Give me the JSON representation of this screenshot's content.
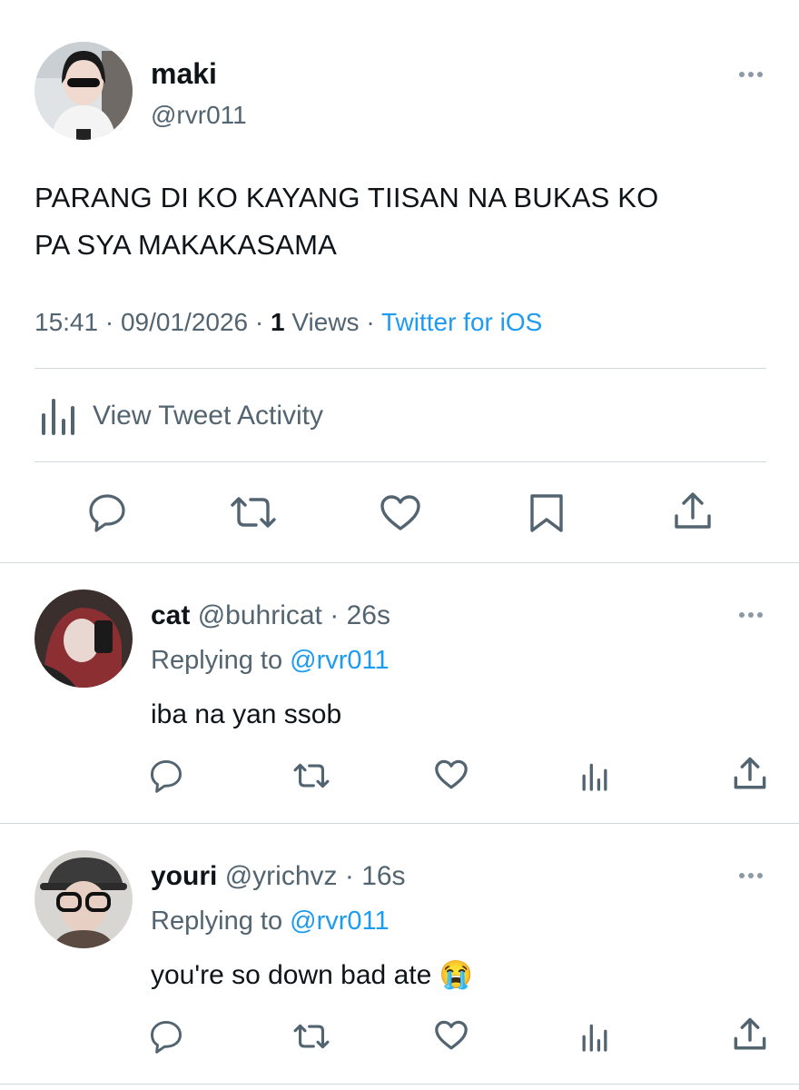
{
  "main_tweet": {
    "display_name": "maki",
    "handle": "@rvr011",
    "text_line1": "PARANG DI KO KAYANG TIISAN NA BUKAS KO",
    "text_line2": "PA SYA MAKAKASAMA",
    "time": "15:41",
    "date": "09/01/2026",
    "views_count": "1",
    "views_label": "Views",
    "source": "Twitter for iOS",
    "activity_label": "View Tweet Activity"
  },
  "replies": [
    {
      "display_name": "cat",
      "handle": "@buhricat",
      "time": "26s",
      "replying_label": "Replying to",
      "replying_handle": "@rvr011",
      "text": "iba na yan ssob"
    },
    {
      "display_name": "youri",
      "handle": "@yrichvz",
      "time": "16s",
      "replying_label": "Replying to",
      "replying_handle": "@rvr011",
      "text": "you're so down bad ate",
      "emoji": "😭"
    }
  ],
  "separator": "·",
  "colors": {
    "link": "#1d9bf0",
    "muted": "#536471",
    "divider": "#cfd9de"
  }
}
